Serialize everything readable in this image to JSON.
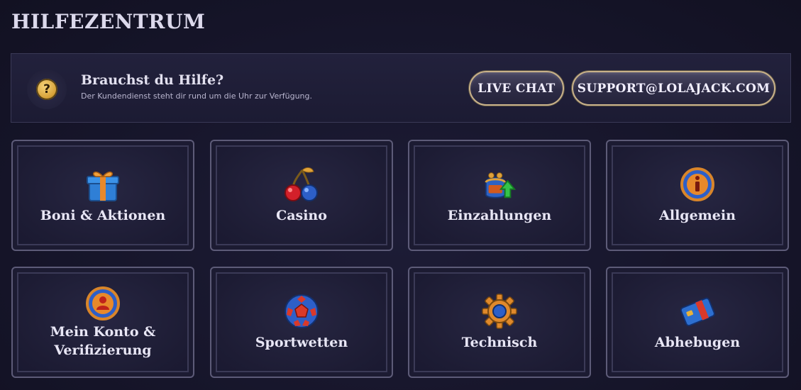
{
  "page": {
    "title": "HILFEZENTRUM"
  },
  "help": {
    "icon": "question-mark-icon",
    "icon_glyph": "?",
    "title": "Brauchst du Hilfe?",
    "subtitle": "Der Kundendienst steht dir rund um die Uhr zur Verfügung.",
    "live_chat_label": "LIVE CHAT",
    "email_label": "SUPPORT@LOLAJACK.COM"
  },
  "categories": [
    {
      "label": "Boni & Aktionen",
      "icon": "gift-box-icon"
    },
    {
      "label": "Casino",
      "icon": "cherries-icon"
    },
    {
      "label": "Einzahlungen",
      "icon": "coin-purse-arrow-icon"
    },
    {
      "label": "Allgemein",
      "icon": "info-icon"
    },
    {
      "label": "Mein Konto &\nVerifizierung",
      "icon": "user-profile-icon"
    },
    {
      "label": "Sportwetten",
      "icon": "soccer-ball-icon"
    },
    {
      "label": "Technisch",
      "icon": "gear-icon"
    },
    {
      "label": "Abhebugen",
      "icon": "credit-card-icon"
    }
  ],
  "colors": {
    "background": "#16152a",
    "accent_gold": "#c9b28a",
    "text": "#e6e4f2"
  }
}
